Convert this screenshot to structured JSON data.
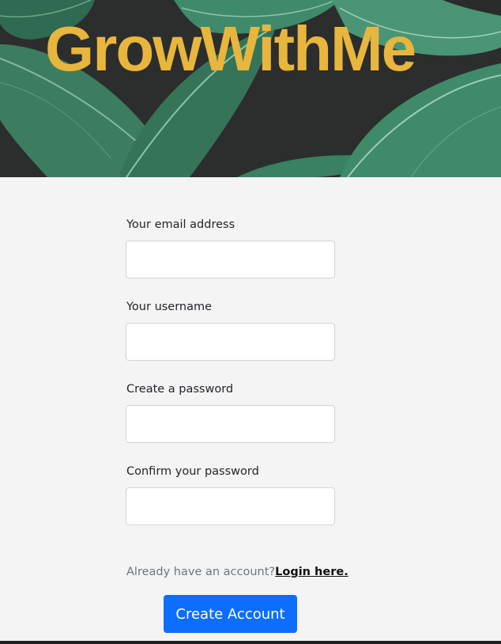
{
  "brand": {
    "title": "GrowWithMe",
    "color": "#e8b63d"
  },
  "form": {
    "fields": [
      {
        "label": "Your email address",
        "value": "",
        "placeholder": ""
      },
      {
        "label": "Your username",
        "value": "",
        "placeholder": ""
      },
      {
        "label": "Create a password",
        "value": "",
        "placeholder": ""
      },
      {
        "label": "Confirm your password",
        "value": "",
        "placeholder": ""
      }
    ],
    "login_prompt": "Already have an account?",
    "login_link": "Login here.",
    "submit_label": "Create Account"
  },
  "colors": {
    "hero_background": "#2f3030",
    "page_background": "#f4f4f4",
    "button": "#0d6efd",
    "leaf_green": "#3f8a6a"
  }
}
